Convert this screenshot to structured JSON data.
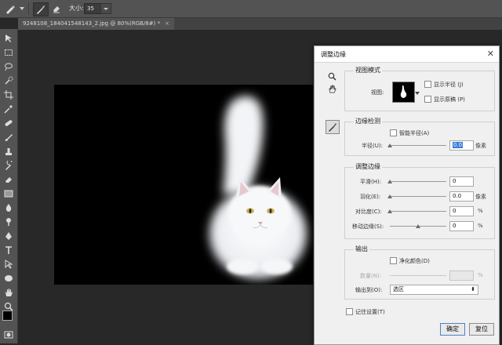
{
  "options_bar": {
    "size_label": "大小:",
    "size_value": "35"
  },
  "document_tab": {
    "title": "9248108_184041548143_2.jpg @ 80%(RGB/8#) *",
    "close": "×"
  },
  "dialog": {
    "title": "调整边缘",
    "close": "✕",
    "view_mode": {
      "group_label": "视图模式",
      "view_label": "视图:",
      "show_radius": "显示半径 (J)",
      "show_original": "显示原稿 (P)"
    },
    "edge_detection": {
      "group_label": "边缘检测",
      "smart_radius": "智能半径(A)",
      "radius_label": "半径(U):",
      "radius_value": "0.0",
      "radius_unit": "像素"
    },
    "adjust_edge": {
      "group_label": "调整边缘",
      "smooth_label": "平滑(H):",
      "smooth_value": "0",
      "feather_label": "羽化(E):",
      "feather_value": "0.0",
      "feather_unit": "像素",
      "contrast_label": "对比度(C):",
      "contrast_value": "0",
      "contrast_unit": "%",
      "shift_label": "移动边缘(S):",
      "shift_value": "0",
      "shift_unit": "%"
    },
    "output": {
      "group_label": "输出",
      "decontaminate": "净化颜色(D)",
      "amount_label": "数量(N):",
      "amount_unit": "%",
      "output_to_label": "输出到(O):",
      "output_to_value": "选区"
    },
    "remember": "记住设置(T)",
    "ok": "确定",
    "reset": "复位"
  }
}
